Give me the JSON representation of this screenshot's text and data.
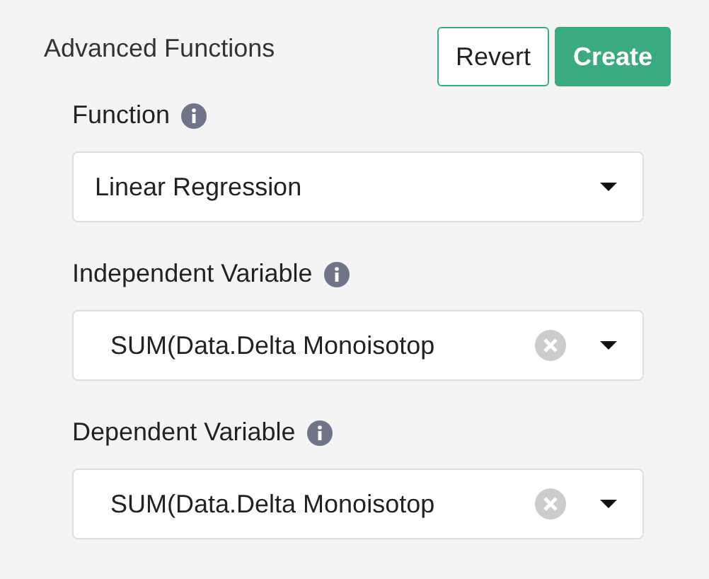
{
  "title": "Advanced Functions",
  "buttons": [
    {
      "label": "Revert",
      "kind": "secondary"
    },
    {
      "label": "Create",
      "kind": "primary"
    }
  ],
  "fields": [
    {
      "label": "Function",
      "value": "Linear Regression",
      "kind": "select"
    },
    {
      "label": "Independent Variable",
      "value": "SUM(Data.Delta Monoisotop",
      "kind": "clearable"
    },
    {
      "label": "Dependent Variable",
      "value": "SUM(Data.Delta Monoisotop",
      "kind": "clearable"
    }
  ]
}
